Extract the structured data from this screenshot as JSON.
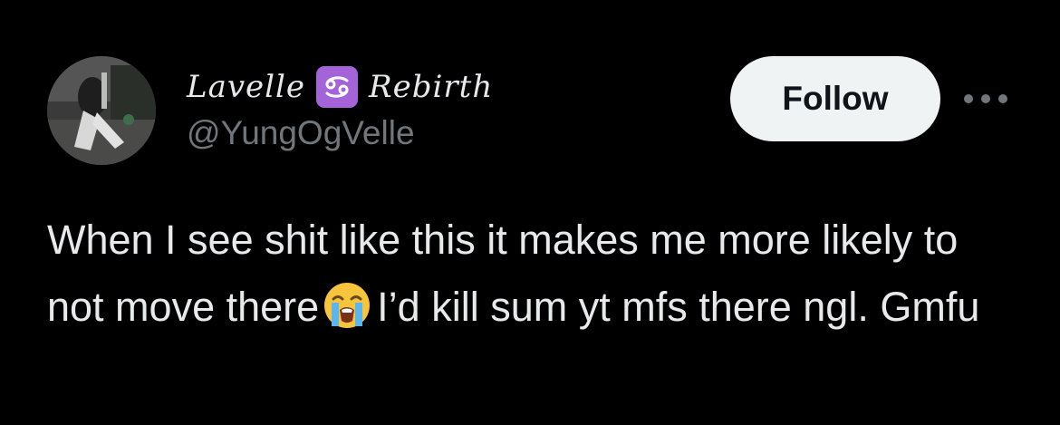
{
  "user": {
    "display_name_first": "Lavelle",
    "display_name_second": "Rebirth",
    "zodiac_badge_icon": "cancer-zodiac-icon",
    "handle": "@YungOgVelle"
  },
  "actions": {
    "follow_label": "Follow",
    "more_icon": "more-dots-icon"
  },
  "tweet": {
    "text_before_emoji": "When I see shit like this it makes me more likely to not move there",
    "emoji_icon": "loudly-crying-face-icon",
    "text_after_emoji": "I’d kill sum yt mfs there ngl. Gmfu"
  },
  "colors": {
    "background": "#000000",
    "text_primary": "#e7e9ea",
    "text_secondary": "#71767b",
    "follow_bg": "#eff3f4",
    "zodiac_badge": "#a463d6"
  }
}
